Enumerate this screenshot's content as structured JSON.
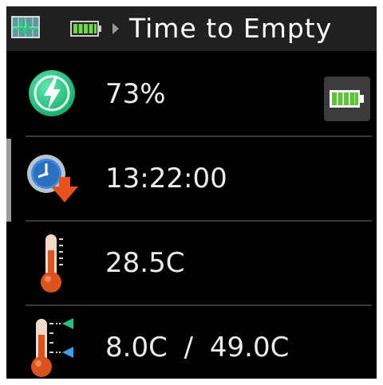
{
  "header": {
    "title": "Time to Empty",
    "icons": [
      "monitor-icon",
      "battery-icon",
      "arrow-right-icon"
    ]
  },
  "rows": [
    {
      "name": "charge",
      "icon": "lightning-icon",
      "value": "73%",
      "badge_icon": "battery-full-icon"
    },
    {
      "name": "time-to-empty",
      "icon": "clock-down-icon",
      "value": "13:22:00"
    },
    {
      "name": "temperature",
      "icon": "thermometer-icon",
      "value": "28.5C"
    },
    {
      "name": "temperature-limits",
      "icon": "thermometer-limits-icon",
      "value": "8.0C / 49.0C"
    }
  ],
  "colors": {
    "background": "#000000",
    "header": "#202020",
    "battery_green": "#6fd64a",
    "accent_green": "#2ecc8a",
    "thermometer": "#d9541e"
  }
}
